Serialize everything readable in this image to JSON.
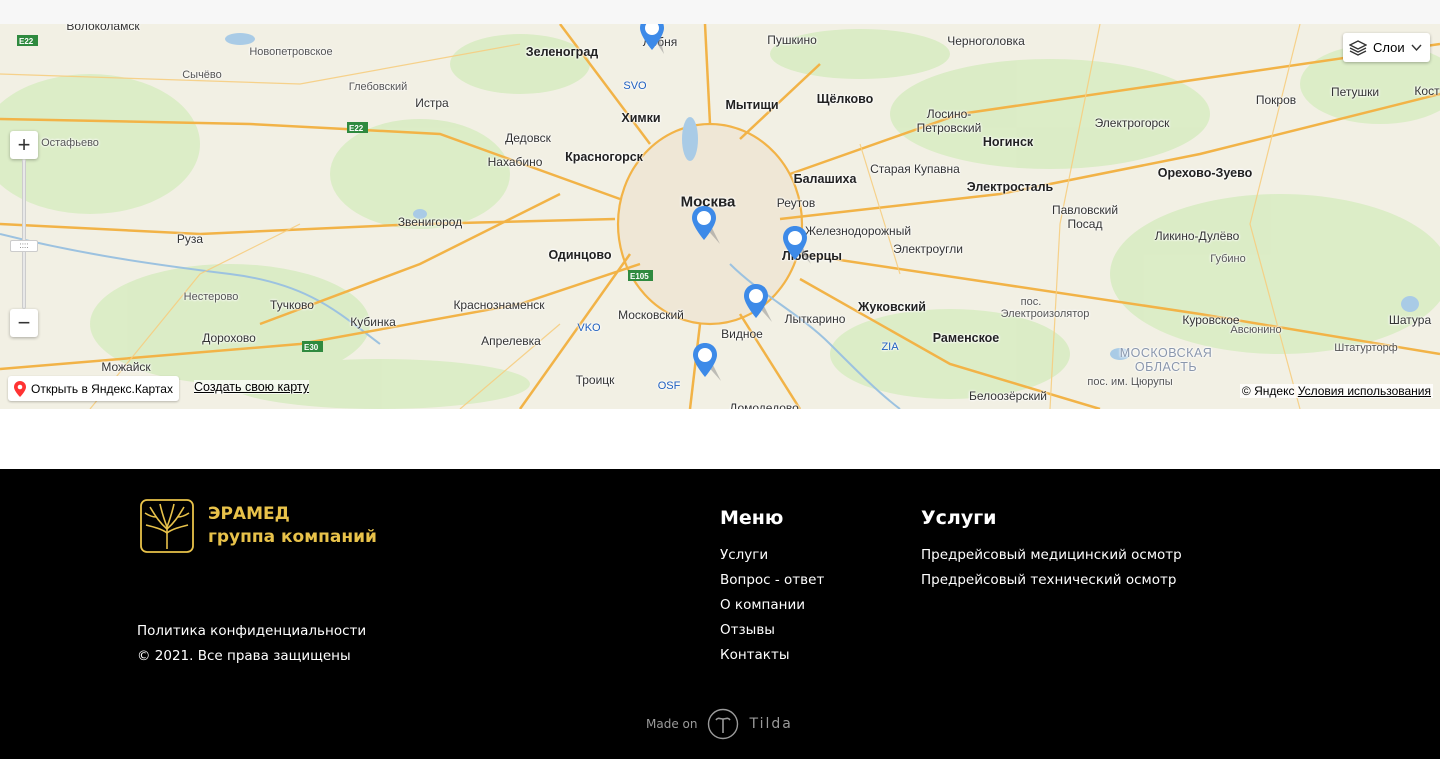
{
  "map": {
    "layers_label": "Слои",
    "zoom_in": "+",
    "zoom_out": "−",
    "zoom_handle": "::::",
    "open_yandex_label": "Открыть в Яндекс.Картах",
    "create_map_label": "Создать свою карту",
    "copyright": "© Яндекс",
    "terms_label": "Условия использования",
    "cities": [
      "Волоколамск",
      "Зеленоград",
      "Лобня",
      "Пушкино",
      "Черноголовка",
      "Новопетровское",
      "Сычёво",
      "Глебовский",
      "Истра",
      "Мытищи",
      "Щёлково",
      "Лосино-Петровский",
      "Петушки",
      "Кост",
      "Покров",
      "Электрогорск",
      "Химки",
      "Дедовск",
      "Остафьево",
      "Нахабино",
      "Красногорск",
      "Ногинск",
      "Балашиха",
      "Старая Купавна",
      "Орехово-Зуево",
      "Москва",
      "Реутов",
      "Электросталь",
      "Павловский Посад",
      "Звенигород",
      "Железнодорожный",
      "Руза",
      "Одинцово",
      "Люберцы",
      "Электроугли",
      "Ликино-Дулёво",
      "Губино",
      "Нестерово",
      "Тучково",
      "Краснознаменск",
      "Московский",
      "Жуковский",
      "пос.",
      "Электроизолятор",
      "Куровское",
      "Авсюнино",
      "Шатура",
      "Кубинка",
      "Дорохово",
      "Апрелевка",
      "Видное",
      "Лыткарино",
      "Раменское",
      "Штатурторф",
      "Можайск",
      "Троицк",
      "пос. им. Цюрупы",
      "Белоозёрский",
      "Домодедово",
      "МОСКОВСКАЯ ОБЛАСТЬ"
    ],
    "airports": [
      "SVO",
      "VKO",
      "ZIA",
      "OSF"
    ],
    "highway_labels": [
      "E22",
      "E22",
      "E105",
      "E30"
    ]
  },
  "footer": {
    "logo": {
      "line1": "ЭРАМЕД",
      "line2": "группа компаний"
    },
    "menu_title": "Меню",
    "menu_items": [
      "Услуги",
      "Вопрос - ответ",
      "О компании",
      "Отзывы",
      "Контакты"
    ],
    "services_title": "Услуги",
    "services_items": [
      "Предрейсовый медицинский осмотр",
      "Предрейсовый технический осмотр"
    ],
    "privacy": "Политика конфиденциальности",
    "copyright": "© 2021. Все права защищены",
    "made_on": "Made on",
    "tilda": "Tilda"
  },
  "colors": {
    "brand_gold": "#e8c24a",
    "footer_bg": "#000000",
    "pin_blue": "#3d8ae8"
  }
}
